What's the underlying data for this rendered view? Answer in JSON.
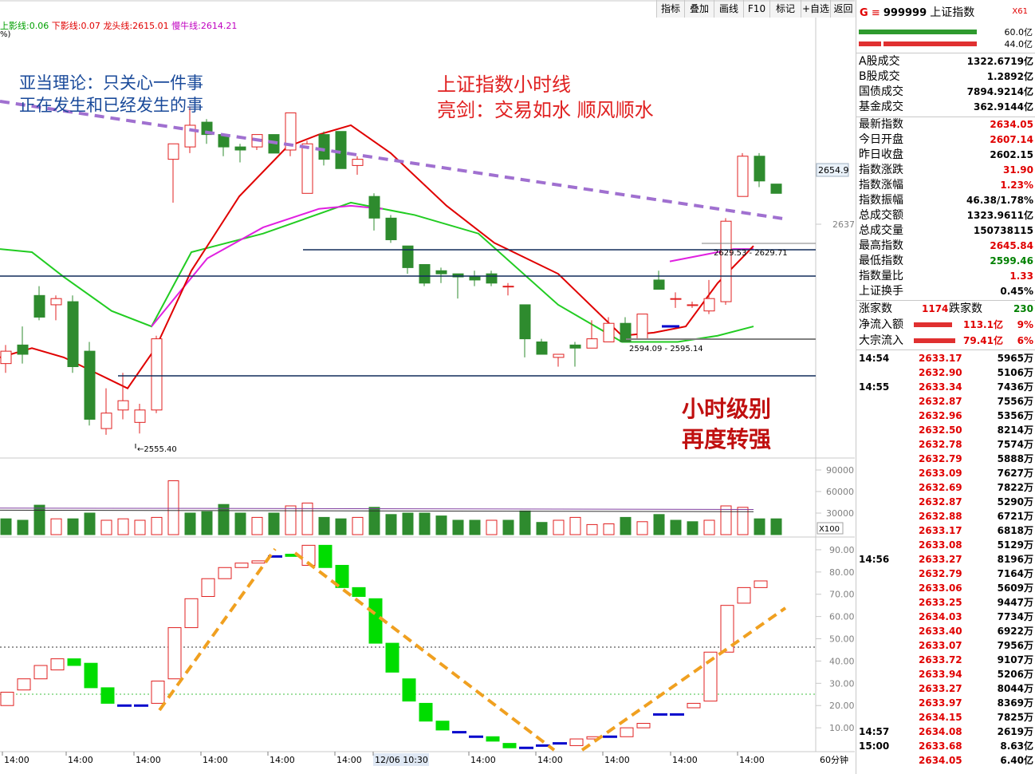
{
  "toolbar": [
    "指标",
    "叠加",
    "画线",
    "F10",
    "标记",
    "+自选",
    "返回"
  ],
  "legend": {
    "prefix": "上影线:",
    "upper": "0.06",
    "lower_label": "下影线:",
    "lower": "0.07",
    "dragon_label": "龙头线:",
    "dragon": "2615.01",
    "bull_label": "慢牛线:",
    "bull": "2614.21",
    "pct": "%)"
  },
  "annotations": {
    "adam_line1": "亚当理论：只关心一件事",
    "adam_line2": "正在发生和已经发生的事",
    "title_line1": "上证指数小时线",
    "title_line2": "亮剑：交易如水 顺风顺水",
    "strong_line1": "小时级别",
    "strong_line2": "再度转强",
    "range_upper": "2629.53 - 2629.71",
    "range_lower": "2594.09 - 2595.14",
    "low_marker": "2555.40"
  },
  "price_axis": {
    "top_label": "2654.9",
    "mid_label": "2637"
  },
  "volume_axis": [
    "90000",
    "60000",
    "30000"
  ],
  "volume_unit": "X100",
  "osc_axis": [
    "90.00",
    "80.00",
    "70.00",
    "60.00",
    "50.00",
    "40.00",
    "30.00",
    "20.00",
    "10.00"
  ],
  "time_axis": [
    "14:00",
    "14:00",
    "14:00",
    "14:00",
    "14:00",
    "14:00",
    "12/06 10:30",
    "14:00",
    "14:00",
    "14:00",
    "14:00",
    "14:00"
  ],
  "period_label": "60分钟",
  "colors": {
    "up": "#e02020",
    "down": "#2e8b2e",
    "osc_up": "#e02020",
    "osc_down": "#00dd00",
    "dash_purple": "#a070d0",
    "dash_orange": "#f0a020"
  },
  "chart_data": {
    "type": "candlestick",
    "title": "上证指数小时线",
    "candles": [
      {
        "o": 2578,
        "h": 2584,
        "l": 2575,
        "c": 2582
      },
      {
        "o": 2584,
        "h": 2590,
        "l": 2578,
        "c": 2581
      },
      {
        "o": 2600,
        "h": 2603,
        "l": 2592,
        "c": 2593
      },
      {
        "o": 2597,
        "h": 2600,
        "l": 2592,
        "c": 2599
      },
      {
        "o": 2598,
        "h": 2600,
        "l": 2575,
        "c": 2577
      },
      {
        "o": 2582,
        "h": 2585,
        "l": 2558,
        "c": 2560
      },
      {
        "o": 2557,
        "h": 2570,
        "l": 2555,
        "c": 2562
      },
      {
        "o": 2563,
        "h": 2575,
        "l": 2560,
        "c": 2566
      },
      {
        "o": 2559,
        "h": 2565,
        "l": 2555.4,
        "c": 2563
      },
      {
        "o": 2563,
        "h": 2587,
        "l": 2562,
        "c": 2586
      },
      {
        "o": 2644,
        "h": 2648,
        "l": 2630,
        "c": 2649
      },
      {
        "o": 2648,
        "h": 2661,
        "l": 2646,
        "c": 2655
      },
      {
        "o": 2656,
        "h": 2657,
        "l": 2649,
        "c": 2652
      },
      {
        "o": 2652,
        "h": 2652,
        "l": 2645,
        "c": 2648
      },
      {
        "o": 2648,
        "h": 2649,
        "l": 2643,
        "c": 2647
      },
      {
        "o": 2648,
        "h": 2652,
        "l": 2647,
        "c": 2652
      },
      {
        "o": 2652,
        "h": 2652,
        "l": 2646,
        "c": 2646
      },
      {
        "o": 2647,
        "h": 2659,
        "l": 2645,
        "c": 2659
      },
      {
        "o": 2633,
        "h": 2650,
        "l": 2633,
        "c": 2649
      },
      {
        "o": 2652,
        "h": 2653,
        "l": 2642,
        "c": 2644
      },
      {
        "o": 2653,
        "h": 2653,
        "l": 2641,
        "c": 2641
      },
      {
        "o": 2642,
        "h": 2645,
        "l": 2639,
        "c": 2644
      },
      {
        "o": 2632,
        "h": 2633,
        "l": 2621,
        "c": 2625
      },
      {
        "o": 2625,
        "h": 2626,
        "l": 2617,
        "c": 2618
      },
      {
        "o": 2616,
        "h": 2616,
        "l": 2607,
        "c": 2609
      },
      {
        "o": 2610,
        "h": 2610,
        "l": 2603,
        "c": 2604
      },
      {
        "o": 2608,
        "h": 2609,
        "l": 2604,
        "c": 2607
      },
      {
        "o": 2607,
        "h": 2607,
        "l": 2599,
        "c": 2606
      },
      {
        "o": 2606,
        "h": 2608,
        "l": 2603,
        "c": 2605
      },
      {
        "o": 2607,
        "h": 2608,
        "l": 2603,
        "c": 2604
      },
      {
        "o": 2603,
        "h": 2604,
        "l": 2600,
        "c": 2603
      },
      {
        "o": 2597,
        "h": 2597,
        "l": 2580,
        "c": 2586
      },
      {
        "o": 2585,
        "h": 2586,
        "l": 2581,
        "c": 2581
      },
      {
        "o": 2580,
        "h": 2581,
        "l": 2577,
        "c": 2581
      },
      {
        "o": 2584,
        "h": 2585,
        "l": 2577,
        "c": 2583
      },
      {
        "o": 2583,
        "h": 2592,
        "l": 2583,
        "c": 2586
      },
      {
        "o": 2585,
        "h": 2593,
        "l": 2585,
        "c": 2591
      },
      {
        "o": 2591,
        "h": 2593,
        "l": 2585,
        "c": 2585
      },
      {
        "o": 2586,
        "h": 2594,
        "l": 2586,
        "c": 2594
      },
      {
        "o": 2605,
        "h": 2608,
        "l": 2602,
        "c": 2602
      },
      {
        "o": 2599,
        "h": 2601,
        "l": 2596,
        "c": 2599
      },
      {
        "o": 2597,
        "h": 2598,
        "l": 2596,
        "c": 2597
      },
      {
        "o": 2595,
        "h": 2605,
        "l": 2594,
        "c": 2599
      },
      {
        "o": 2598,
        "h": 2625,
        "l": 2597,
        "c": 2624
      },
      {
        "o": 2632,
        "h": 2646,
        "l": 2632,
        "c": 2645
      },
      {
        "o": 2645,
        "h": 2646,
        "l": 2635,
        "c": 2637
      },
      {
        "o": 2636,
        "h": 2636,
        "l": 2633,
        "c": 2633
      }
    ],
    "ylim": [
      2548,
      2680
    ],
    "volume": [
      {
        "v": 22000,
        "up": false
      },
      {
        "v": 20000,
        "up": false
      },
      {
        "v": 41000,
        "up": false
      },
      {
        "v": 22000,
        "up": true
      },
      {
        "v": 22000,
        "up": false
      },
      {
        "v": 30000,
        "up": false
      },
      {
        "v": 20000,
        "up": true
      },
      {
        "v": 22000,
        "up": true
      },
      {
        "v": 20000,
        "up": true
      },
      {
        "v": 24000,
        "up": true
      },
      {
        "v": 75000,
        "up": true
      },
      {
        "v": 30000,
        "up": false
      },
      {
        "v": 32000,
        "up": false
      },
      {
        "v": 42000,
        "up": false
      },
      {
        "v": 30000,
        "up": false
      },
      {
        "v": 24000,
        "up": true
      },
      {
        "v": 30000,
        "up": false
      },
      {
        "v": 40000,
        "up": true
      },
      {
        "v": 44000,
        "up": true
      },
      {
        "v": 24000,
        "up": false
      },
      {
        "v": 22000,
        "up": false
      },
      {
        "v": 24000,
        "up": true
      },
      {
        "v": 38000,
        "up": false
      },
      {
        "v": 28000,
        "up": false
      },
      {
        "v": 30000,
        "up": false
      },
      {
        "v": 30000,
        "up": false
      },
      {
        "v": 26000,
        "up": false
      },
      {
        "v": 20000,
        "up": false
      },
      {
        "v": 20000,
        "up": false
      },
      {
        "v": 20000,
        "up": true
      },
      {
        "v": 20000,
        "up": false
      },
      {
        "v": 33000,
        "up": false
      },
      {
        "v": 17000,
        "up": false
      },
      {
        "v": 20000,
        "up": true
      },
      {
        "v": 24000,
        "up": true
      },
      {
        "v": 14000,
        "up": true
      },
      {
        "v": 15000,
        "up": true
      },
      {
        "v": 24000,
        "up": false
      },
      {
        "v": 18000,
        "up": true
      },
      {
        "v": 28000,
        "up": false
      },
      {
        "v": 20000,
        "up": false
      },
      {
        "v": 18000,
        "up": false
      },
      {
        "v": 20000,
        "up": true
      },
      {
        "v": 40000,
        "up": true
      },
      {
        "v": 38000,
        "up": true
      },
      {
        "v": 22000,
        "up": false
      },
      {
        "v": 22000,
        "up": false
      }
    ],
    "volume_ylim": [
      0,
      100000
    ],
    "osc": [
      {
        "o": 20,
        "c": 26
      },
      {
        "o": 27,
        "c": 32
      },
      {
        "o": 32,
        "c": 38
      },
      {
        "o": 36,
        "c": 41
      },
      {
        "o": 41,
        "c": 38
      },
      {
        "o": 39,
        "c": 28
      },
      {
        "o": 28,
        "c": 21
      },
      {
        "o": 20,
        "c": 20
      },
      {
        "o": 20,
        "c": 20
      },
      {
        "o": 21,
        "c": 31
      },
      {
        "o": 32,
        "c": 55
      },
      {
        "o": 55,
        "c": 68
      },
      {
        "o": 69,
        "c": 77
      },
      {
        "o": 77,
        "c": 82
      },
      {
        "o": 82,
        "c": 84
      },
      {
        "o": 84,
        "c": 85
      },
      {
        "o": 87,
        "c": 87
      },
      {
        "o": 88,
        "c": 87
      },
      {
        "o": 83,
        "c": 92
      },
      {
        "o": 92,
        "c": 82
      },
      {
        "o": 83,
        "c": 73
      },
      {
        "o": 73,
        "c": 69
      },
      {
        "o": 68,
        "c": 48
      },
      {
        "o": 48,
        "c": 35
      },
      {
        "o": 32,
        "c": 22
      },
      {
        "o": 21,
        "c": 13
      },
      {
        "o": 13,
        "c": 9
      },
      {
        "o": 8,
        "c": 8
      },
      {
        "o": 6,
        "c": 6
      },
      {
        "o": 6,
        "c": 4
      },
      {
        "o": 3,
        "c": 1
      },
      {
        "o": 1,
        "c": 1
      },
      {
        "o": 2,
        "c": 2
      },
      {
        "o": 3,
        "c": 3
      },
      {
        "o": 2,
        "c": 5
      },
      {
        "o": 5,
        "c": 6
      },
      {
        "o": 6,
        "c": 6
      },
      {
        "o": 6,
        "c": 10
      },
      {
        "o": 10,
        "c": 12
      },
      {
        "o": 16,
        "c": 16
      },
      {
        "o": 16,
        "c": 16
      },
      {
        "o": 19,
        "c": 21
      },
      {
        "o": 22,
        "c": 44
      },
      {
        "o": 44,
        "c": 65
      },
      {
        "o": 66,
        "c": 73
      },
      {
        "o": 73,
        "c": 76
      }
    ],
    "osc_ylim": [
      0,
      95
    ]
  },
  "side": {
    "flag": "G",
    "code": "999999",
    "name": "上证指数",
    "x61": "X61",
    "bar_top_value": "60.0亿",
    "bar_bottom_value": "44.0亿",
    "turnover": [
      {
        "k": "A股成交",
        "v": "1322.6719亿"
      },
      {
        "k": "B股成交",
        "v": "1.2892亿"
      },
      {
        "k": "国债成交",
        "v": "7894.9214亿"
      },
      {
        "k": "基金成交",
        "v": "362.9144亿"
      }
    ],
    "quotes": [
      {
        "k": "最新指数",
        "v": "2634.05",
        "c": "#e00000"
      },
      {
        "k": "今日开盘",
        "v": "2607.14",
        "c": "#e00000"
      },
      {
        "k": "昨日收盘",
        "v": "2602.15",
        "c": "#000000"
      },
      {
        "k": "指数涨跌",
        "v": "31.90",
        "c": "#e00000"
      },
      {
        "k": "指数涨幅",
        "v": "1.23%",
        "c": "#e00000"
      },
      {
        "k": "指数振幅",
        "v": "46.38/1.78%",
        "c": "#000000"
      },
      {
        "k": "总成交额",
        "v": "1323.9611亿",
        "c": "#000000"
      },
      {
        "k": "总成交量",
        "v": "150738115",
        "c": "#000000"
      },
      {
        "k": "最高指数",
        "v": "2645.84",
        "c": "#e00000"
      },
      {
        "k": "最低指数",
        "v": "2599.46",
        "c": "#008000"
      },
      {
        "k": "指数量比",
        "v": "1.33",
        "c": "#e00000"
      },
      {
        "k": "上证换手",
        "v": "0.45%",
        "c": "#000000"
      }
    ],
    "rise_label": "涨家数",
    "rise": "1174",
    "fall_label": "跌家数",
    "fall": "230",
    "netflow_label": "净流入额",
    "netflow": "113.1亿",
    "netflow_pct": "9%",
    "block_label": "大宗流入",
    "block": "79.41亿",
    "block_pct": "6%",
    "ticks": [
      {
        "t": "14:54",
        "p": "2633.17",
        "q": "5965万"
      },
      {
        "t": "",
        "p": "2632.90",
        "q": "5106万"
      },
      {
        "t": "14:55",
        "p": "2633.34",
        "q": "7436万"
      },
      {
        "t": "",
        "p": "2632.87",
        "q": "7556万"
      },
      {
        "t": "",
        "p": "2632.96",
        "q": "5356万"
      },
      {
        "t": "",
        "p": "2632.50",
        "q": "8214万"
      },
      {
        "t": "",
        "p": "2632.78",
        "q": "7574万"
      },
      {
        "t": "",
        "p": "2632.79",
        "q": "5888万"
      },
      {
        "t": "",
        "p": "2633.09",
        "q": "7627万"
      },
      {
        "t": "",
        "p": "2632.69",
        "q": "7822万"
      },
      {
        "t": "",
        "p": "2632.87",
        "q": "5290万"
      },
      {
        "t": "",
        "p": "2632.88",
        "q": "6721万"
      },
      {
        "t": "",
        "p": "2633.17",
        "q": "6818万"
      },
      {
        "t": "",
        "p": "2633.08",
        "q": "5129万"
      },
      {
        "t": "14:56",
        "p": "2633.27",
        "q": "8196万"
      },
      {
        "t": "",
        "p": "2632.79",
        "q": "7164万"
      },
      {
        "t": "",
        "p": "2633.06",
        "q": "5609万"
      },
      {
        "t": "",
        "p": "2633.25",
        "q": "9447万"
      },
      {
        "t": "",
        "p": "2634.03",
        "q": "7734万"
      },
      {
        "t": "",
        "p": "2633.40",
        "q": "6922万"
      },
      {
        "t": "",
        "p": "2633.07",
        "q": "7956万"
      },
      {
        "t": "",
        "p": "2633.72",
        "q": "9107万"
      },
      {
        "t": "",
        "p": "2633.94",
        "q": "5206万"
      },
      {
        "t": "",
        "p": "2633.27",
        "q": "8044万"
      },
      {
        "t": "",
        "p": "2633.97",
        "q": "8369万"
      },
      {
        "t": "",
        "p": "2634.15",
        "q": "7825万"
      },
      {
        "t": "14:57",
        "p": "2634.08",
        "q": "2619万"
      },
      {
        "t": "15:00",
        "p": "2633.68",
        "q": "8.63亿"
      },
      {
        "t": "",
        "p": "2634.05",
        "q": "6.40亿"
      }
    ]
  }
}
